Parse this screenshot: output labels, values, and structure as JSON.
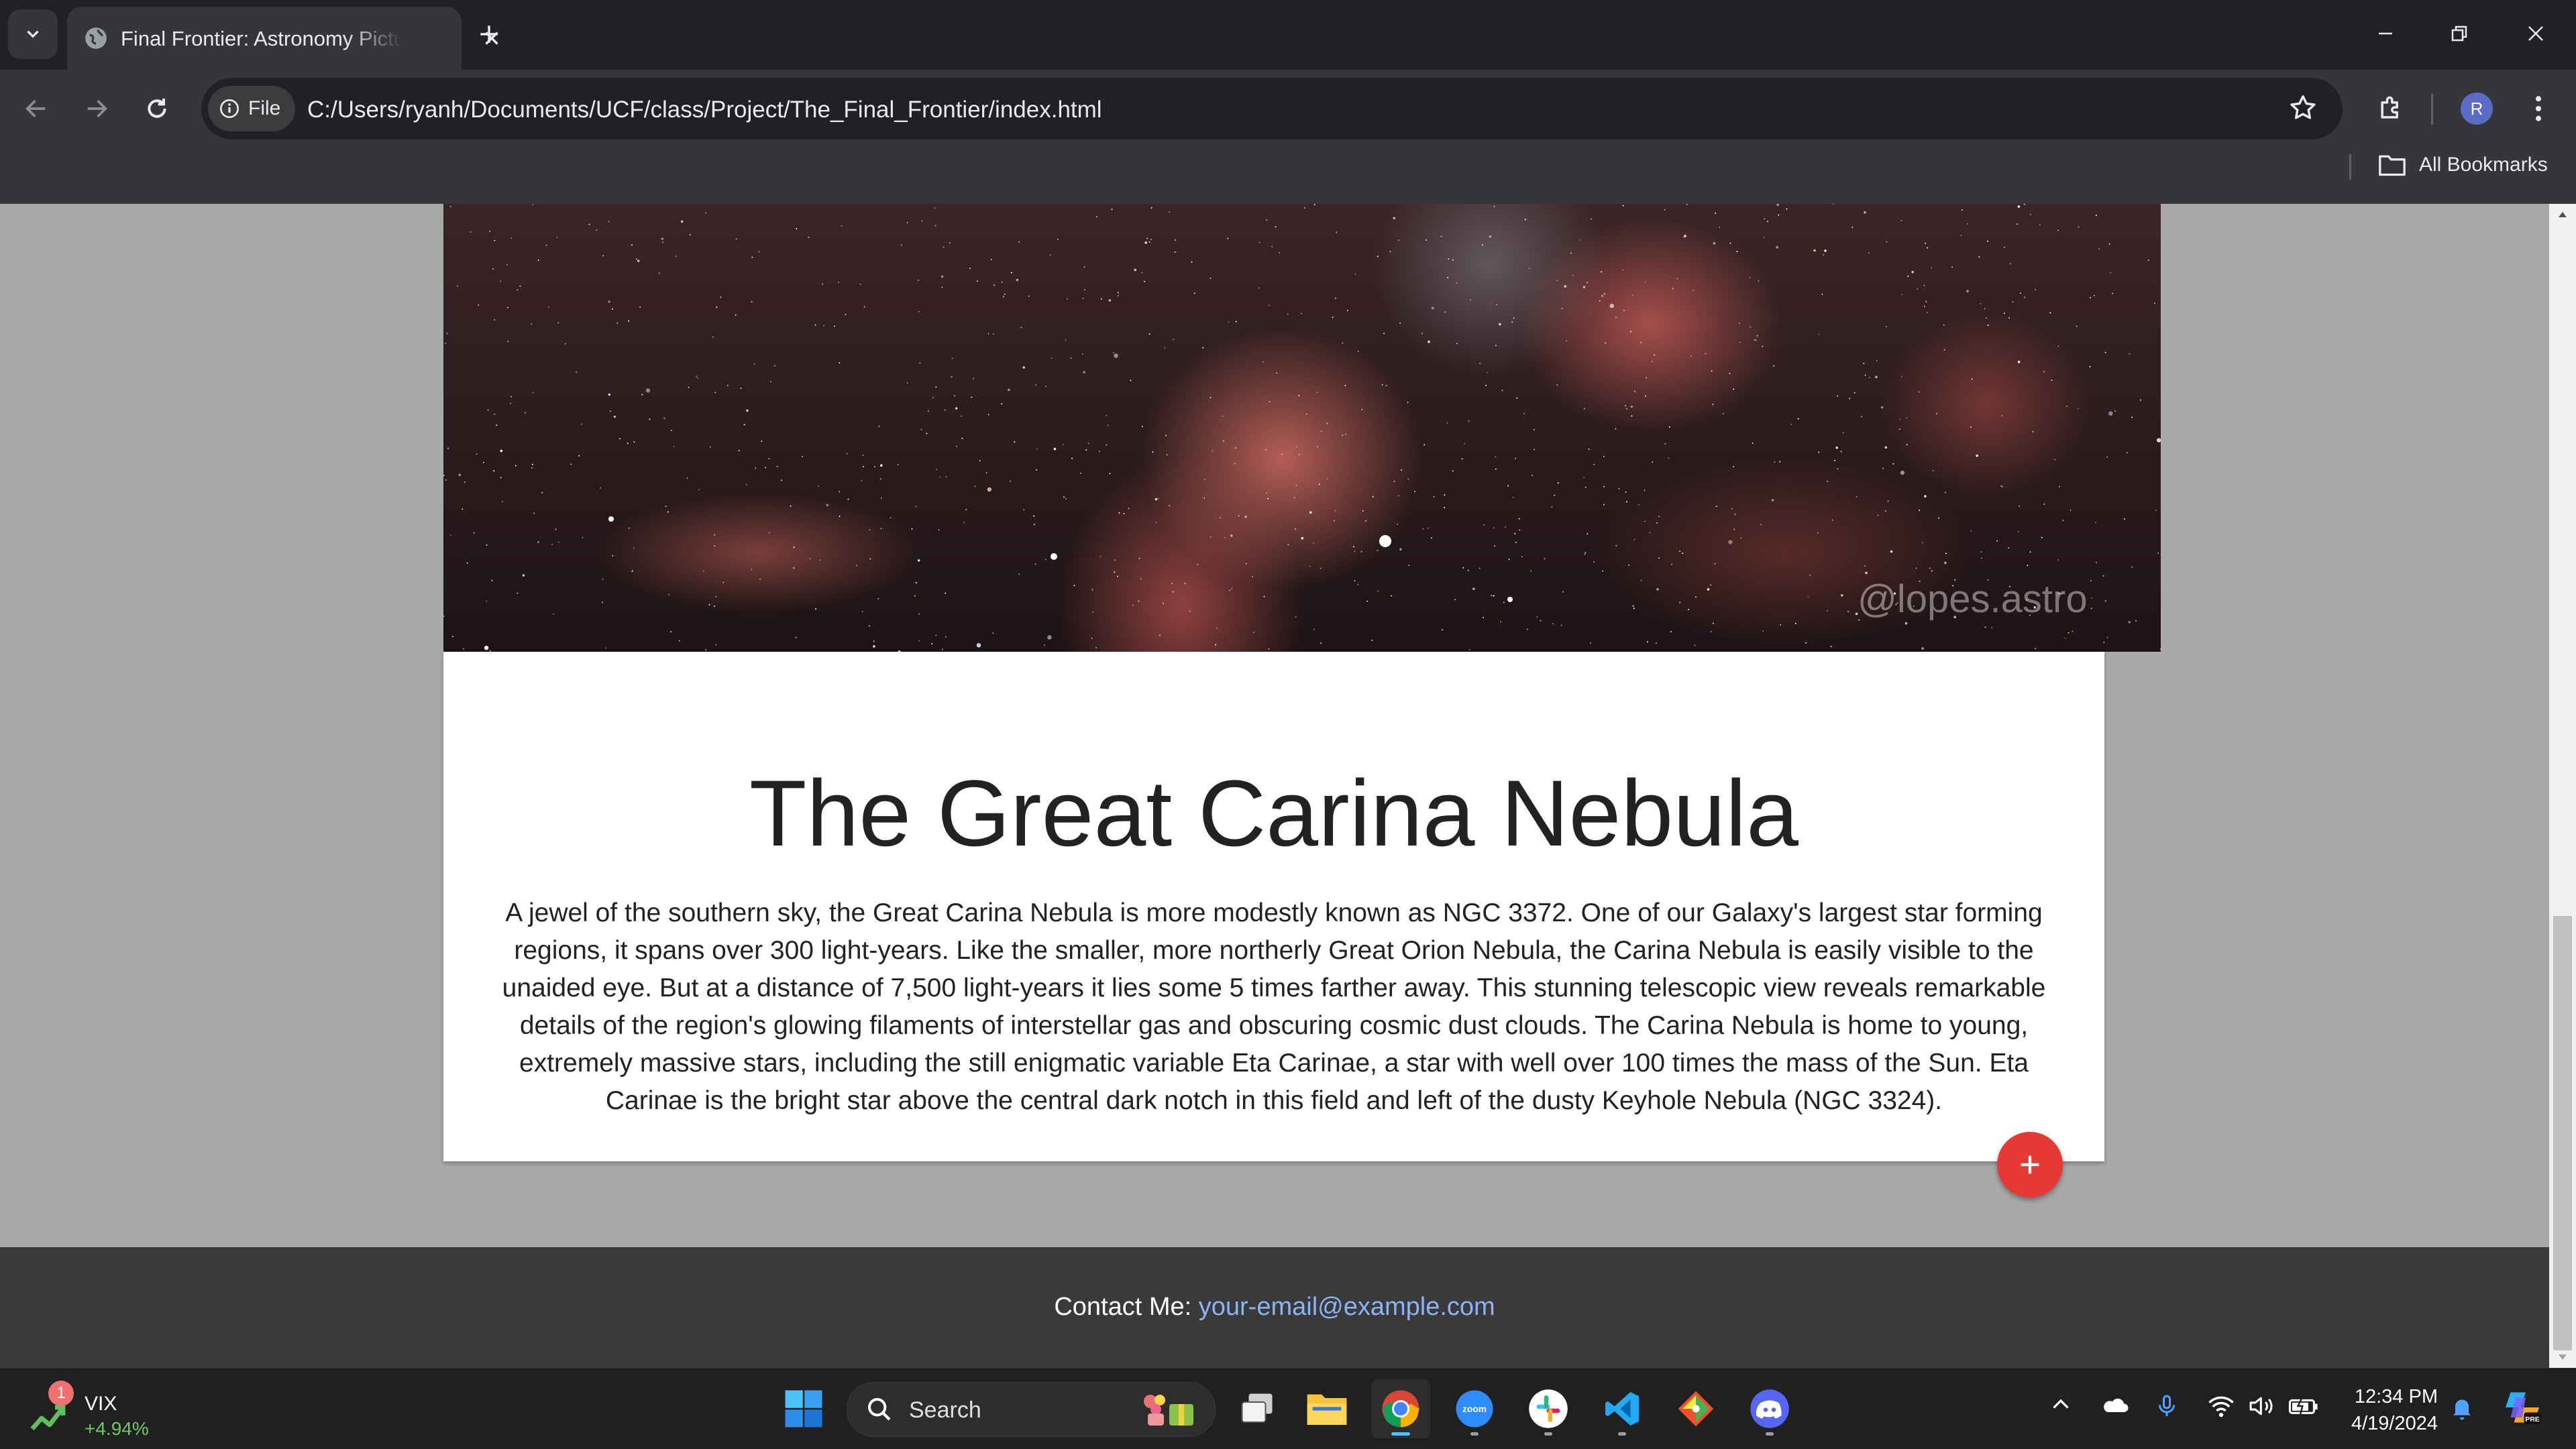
{
  "browser": {
    "tab_title": "Final Frontier: Astronomy Picture of the Day",
    "address_chip": "File",
    "url": "C:/Users/ryanh/Documents/UCF/class/Project/The_Final_Frontier/index.html",
    "bookmarks_label": "All Bookmarks",
    "profile_initial": "R"
  },
  "page": {
    "image_watermark": "@lopes.astro",
    "title": "The Great Carina Nebula",
    "description": "A jewel of the southern sky, the Great Carina Nebula is more modestly known as NGC 3372. One of our Galaxy's largest star forming regions, it spans over 300 light-years. Like the smaller, more northerly Great Orion Nebula, the Carina Nebula is easily visible to the unaided eye. But at a distance of 7,500 light-years it lies some 5 times farther away. This stunning telescopic view reveals remarkable details of the region's glowing filaments of interstellar gas and obscuring cosmic dust clouds. The Carina Nebula is home to young, extremely massive stars, including the still enigmatic variable Eta Carinae, a star with well over 100 times the mass of the Sun. Eta Carinae is the bright star above the central dark notch in this field and left of the dusty Keyhole Nebula (NGC 3324).",
    "fab_label": "+",
    "footer": {
      "contact_label": "Contact Me:",
      "email": "your-email@example.com"
    }
  },
  "taskbar": {
    "widget": {
      "badge": "1",
      "name": "VIX",
      "change": "+4.94%"
    },
    "search_label": "Search",
    "time": "12:34 PM",
    "date": "4/19/2024"
  },
  "colors": {
    "accent_fab": "#e53935",
    "link": "#8ab4f8",
    "page_bg": "#a9a9a9",
    "footer_bg": "#3a3a3a"
  }
}
